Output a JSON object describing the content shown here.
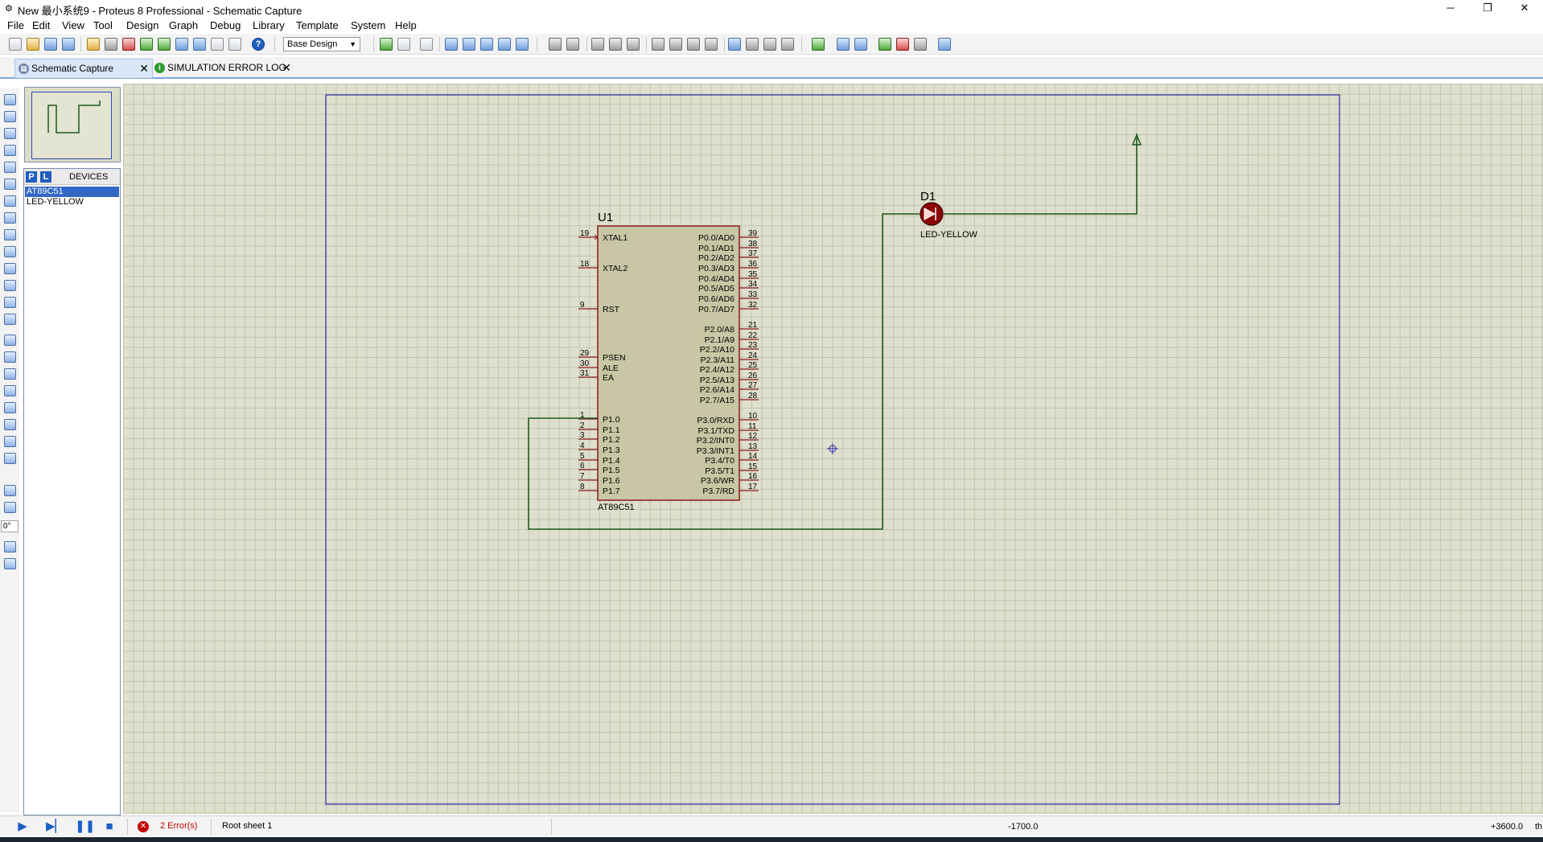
{
  "window": {
    "title": "New 最小系统9 - Proteus 8 Professional - Schematic Capture",
    "app_icon": "proteus-app-icon",
    "controls": {
      "minimize": "─",
      "maximize": "❐",
      "close": "✕"
    }
  },
  "menu": [
    "File",
    "Edit",
    "View",
    "Tool",
    "Design",
    "Graph",
    "Debug",
    "Library",
    "Template",
    "System",
    "Help"
  ],
  "toolbar": {
    "design_variant": "Base Design",
    "help_glyph": "?"
  },
  "tabs": [
    {
      "label": "Schematic Capture",
      "icon": "schematic-icon",
      "active": true,
      "close": "✕"
    },
    {
      "label": "SIMULATION ERROR LOG",
      "icon": "info-icon",
      "active": false,
      "close": "✕"
    }
  ],
  "left_tools": {
    "rotation_angle": "0°"
  },
  "devices_panel": {
    "pick_button": "P",
    "library_button": "L",
    "title": "DEVICES",
    "items": [
      "AT89C51",
      "LED-YELLOW"
    ],
    "selected_index": 0
  },
  "schematic": {
    "u1": {
      "ref": "U1",
      "part": "AT89C51",
      "left_pins": [
        {
          "num": "19",
          "name": "XTAL1"
        },
        {
          "num": "18",
          "name": "XTAL2"
        },
        {
          "num": "9",
          "name": "RST"
        },
        {
          "num": "29",
          "name": "PSEN"
        },
        {
          "num": "30",
          "name": "ALE"
        },
        {
          "num": "31",
          "name": "EA"
        },
        {
          "num": "1",
          "name": "P1.0"
        },
        {
          "num": "2",
          "name": "P1.1"
        },
        {
          "num": "3",
          "name": "P1.2"
        },
        {
          "num": "4",
          "name": "P1.3"
        },
        {
          "num": "5",
          "name": "P1.4"
        },
        {
          "num": "6",
          "name": "P1.5"
        },
        {
          "num": "7",
          "name": "P1.6"
        },
        {
          "num": "8",
          "name": "P1.7"
        }
      ],
      "right_pins": [
        {
          "num": "39",
          "name": "P0.0/AD0"
        },
        {
          "num": "38",
          "name": "P0.1/AD1"
        },
        {
          "num": "37",
          "name": "P0.2/AD2"
        },
        {
          "num": "36",
          "name": "P0.3/AD3"
        },
        {
          "num": "35",
          "name": "P0.4/AD4"
        },
        {
          "num": "34",
          "name": "P0.5/AD5"
        },
        {
          "num": "33",
          "name": "P0.6/AD6"
        },
        {
          "num": "32",
          "name": "P0.7/AD7"
        },
        {
          "num": "21",
          "name": "P2.0/A8"
        },
        {
          "num": "22",
          "name": "P2.1/A9"
        },
        {
          "num": "23",
          "name": "P2.2/A10"
        },
        {
          "num": "24",
          "name": "P2.3/A11"
        },
        {
          "num": "25",
          "name": "P2.4/A12"
        },
        {
          "num": "26",
          "name": "P2.5/A13"
        },
        {
          "num": "27",
          "name": "P2.6/A14"
        },
        {
          "num": "28",
          "name": "P2.7/A15"
        },
        {
          "num": "10",
          "name": "P3.0/RXD"
        },
        {
          "num": "11",
          "name": "P3.1/TXD"
        },
        {
          "num": "12",
          "name": "P3.2/INT0"
        },
        {
          "num": "13",
          "name": "P3.3/INT1"
        },
        {
          "num": "14",
          "name": "P3.4/T0"
        },
        {
          "num": "15",
          "name": "P3.5/T1"
        },
        {
          "num": "16",
          "name": "P3.6/WR"
        },
        {
          "num": "17",
          "name": "P3.7/RD"
        }
      ]
    },
    "d1": {
      "ref": "D1",
      "part": "LED-YELLOW"
    },
    "colors": {
      "component_outline": "#8b1a1a",
      "component_fill": "#c8c6a4",
      "wire": "#1e5a1e",
      "sheet_border": "#2c2ca8",
      "led_body": "#8b0000",
      "background": "#dedfcc"
    }
  },
  "status": {
    "errors": "2 Error(s)",
    "sheet": "Root sheet 1",
    "x_coord": "-1700.0",
    "y_coord": "+3600.0",
    "unit": "th"
  }
}
